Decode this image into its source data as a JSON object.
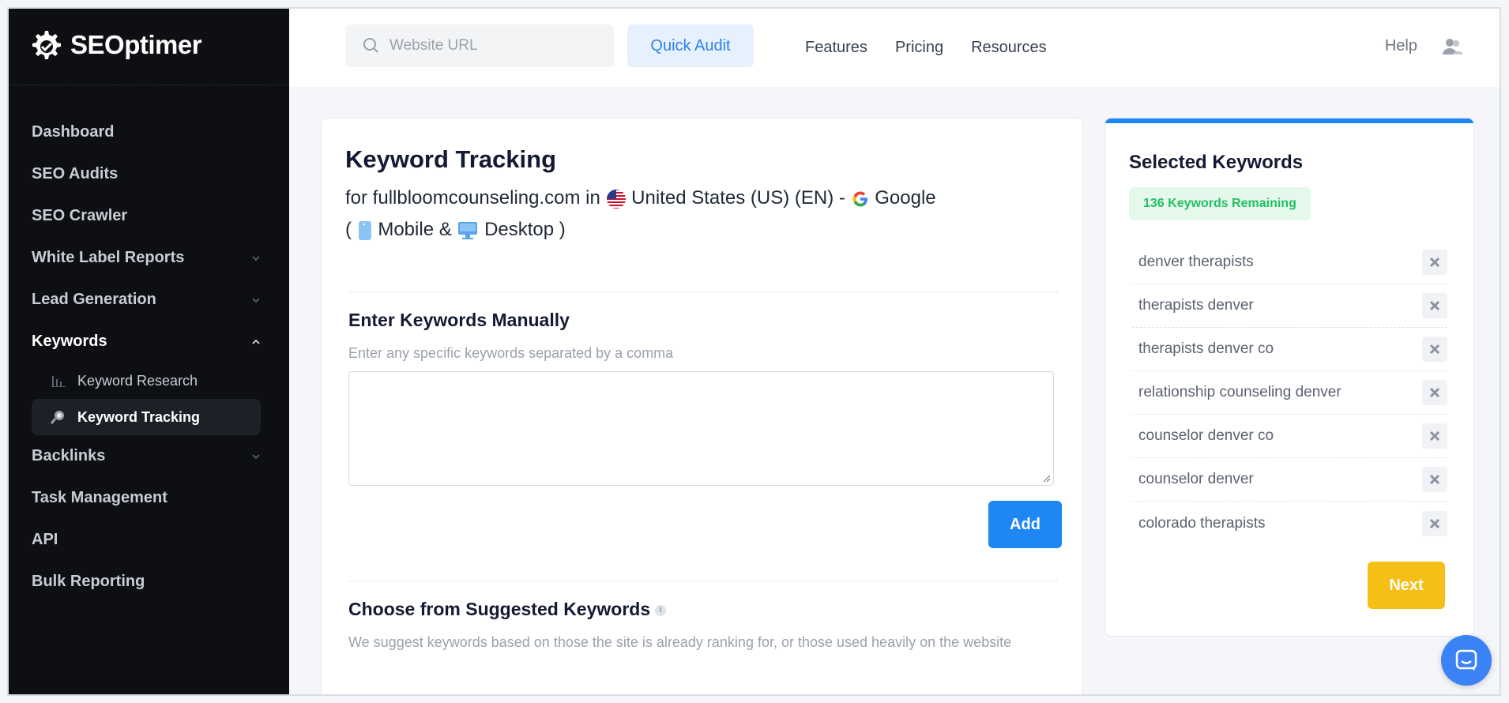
{
  "brand": {
    "name": "SEOptimer"
  },
  "sidebar": {
    "items": [
      {
        "label": "Dashboard"
      },
      {
        "label": "SEO Audits"
      },
      {
        "label": "SEO Crawler"
      },
      {
        "label": "White Label Reports"
      },
      {
        "label": "Lead Generation"
      },
      {
        "label": "Keywords"
      },
      {
        "label": "Backlinks"
      },
      {
        "label": "Task Management"
      },
      {
        "label": "API"
      },
      {
        "label": "Bulk Reporting"
      }
    ],
    "keywords_sub": [
      {
        "label": "Keyword Research"
      },
      {
        "label": "Keyword Tracking"
      }
    ]
  },
  "topbar": {
    "search_placeholder": "Website URL",
    "quick_audit": "Quick Audit",
    "links": [
      "Features",
      "Pricing",
      "Resources"
    ],
    "help": "Help"
  },
  "main": {
    "title": "Keyword Tracking",
    "for_text": "for fullbloomcounseling.com in",
    "country": "United States (US) (EN) -",
    "engine": "Google",
    "paren_open": "(",
    "mobile": "Mobile",
    "amp": "&",
    "desktop": "Desktop",
    "paren_close": ")",
    "manual_heading": "Enter Keywords Manually",
    "manual_hint": "Enter any specific keywords separated by a comma",
    "add_label": "Add",
    "suggest_heading": "Choose from Suggested Keywords",
    "suggest_hint": "We suggest keywords based on those the site is already ranking for, or those used heavily on the website"
  },
  "selected": {
    "title": "Selected Keywords",
    "remaining": "136 Keywords Remaining",
    "keywords": [
      "denver therapists",
      "therapists denver",
      "therapists denver co",
      "relationship counseling denver",
      "counselor denver co",
      "counselor denver",
      "colorado therapists"
    ],
    "next_label": "Next"
  },
  "colors": {
    "sidebar_bg": "#0d0f13",
    "accent_blue": "#1f87f3",
    "next_yellow": "#f5bf16",
    "remaining_green": "#23c063"
  }
}
